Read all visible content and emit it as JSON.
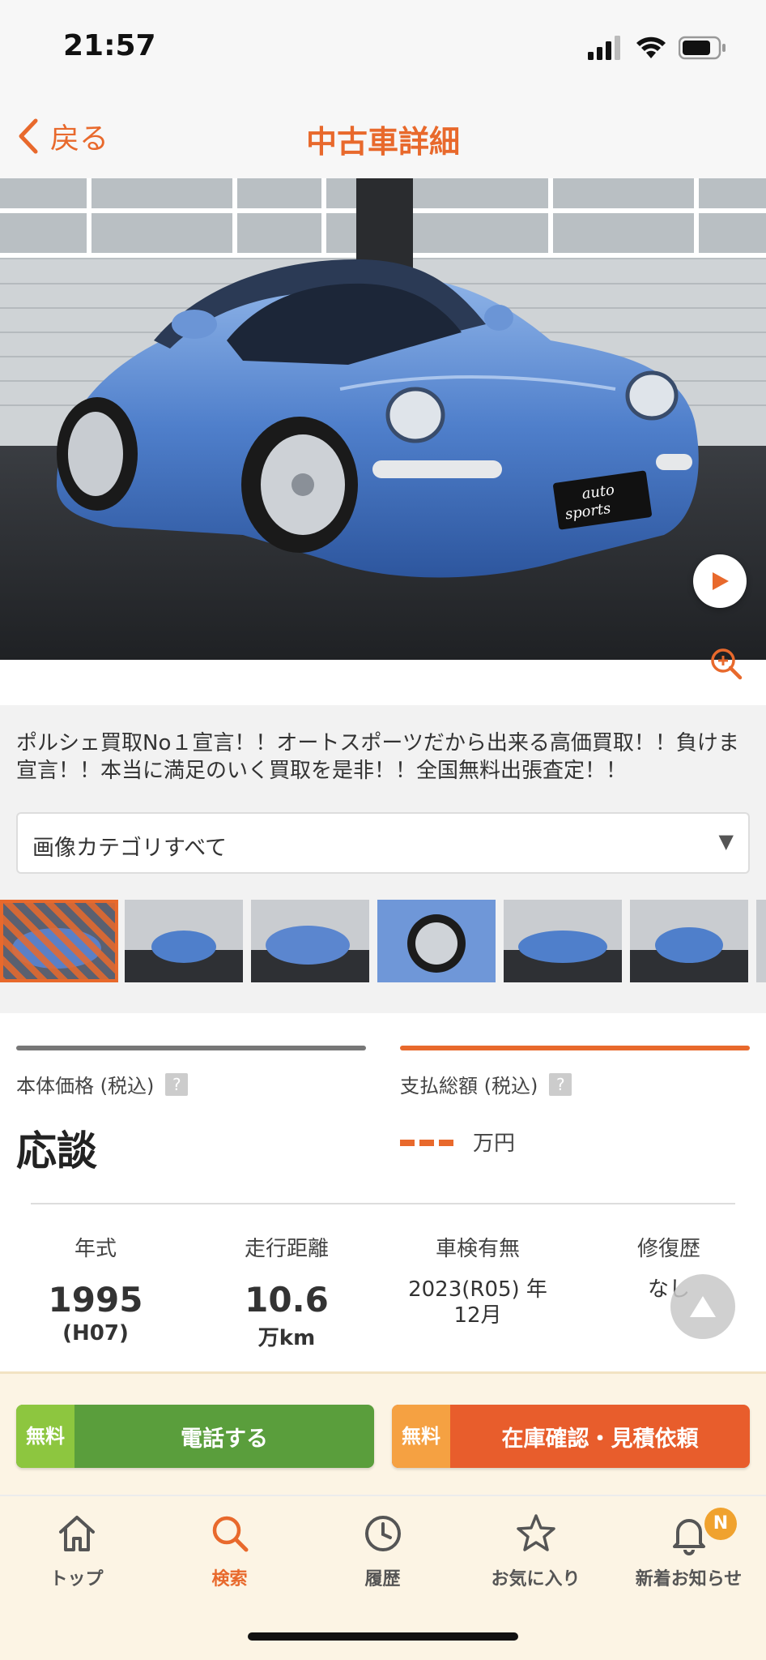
{
  "status_bar": {
    "time": "21:57"
  },
  "nav": {
    "back_label": "戻る",
    "title": "中古車詳細"
  },
  "hero": {
    "plate_text_1": "auto",
    "plate_text_2": "sports"
  },
  "promo_text": "ポルシェ買取No１宣言！！オートスポーツだから出来る高価買取！！負けま宣言！！本当に満足のいく買取を是非！！全国無料出張査定！！",
  "image_category": {
    "selected": "画像カテゴリすべて",
    "arrow": "▼"
  },
  "thumbnails": {
    "count": 7,
    "selected_index": 0
  },
  "price": {
    "base_label": "本体価格 (税込)",
    "base_value": "応談",
    "total_label": "支払総額 (税込)",
    "total_unit": "万円",
    "help_mark": "?"
  },
  "specs": [
    {
      "label": "年式",
      "main": "1995",
      "sub": "(H07)"
    },
    {
      "label": "走行距離",
      "main": "10.6",
      "sub": "万km"
    },
    {
      "label": "車検有無",
      "text": "2023(R05) 年12月"
    },
    {
      "label": "修復歴",
      "text": "なし"
    }
  ],
  "actions": {
    "free_label": "無料",
    "phone_label": "電話する",
    "inquiry_label": "在庫確認・見積依頼"
  },
  "tabs": [
    {
      "label": "トップ",
      "icon": "home-icon"
    },
    {
      "label": "検索",
      "icon": "search-icon",
      "active": true
    },
    {
      "label": "履歴",
      "icon": "clock-icon"
    },
    {
      "label": "お気に入り",
      "icon": "star-icon"
    },
    {
      "label": "新着お知らせ",
      "icon": "bell-icon",
      "badge": "N"
    }
  ],
  "colors": {
    "accent": "#e8692c",
    "green": "#5a9e3c",
    "free_green": "#8dc63f",
    "free_orange": "#f5a142",
    "action_orange": "#e85d2c"
  }
}
